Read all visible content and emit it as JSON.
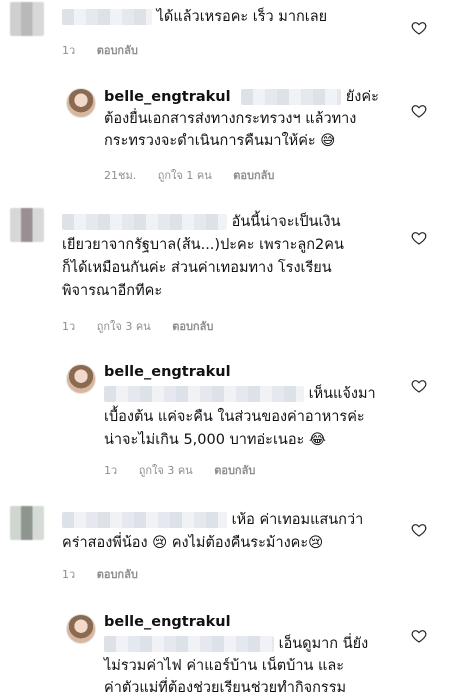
{
  "comments": [
    {
      "lines": [
        "ได้แล้วเหรอคะ  เร็ว มากเลย"
      ],
      "time": "1ว",
      "likes": "",
      "reply": "ตอบกลับ"
    },
    {
      "username": "belle_engtrakul",
      "lines": [
        "ยังค่ะ",
        "ต้องยื่นเอกสารส่งทางกระทรวงฯ แล้วทาง",
        "กระทรวงจะดำเนินการคืนมาให้ค่ะ 😅"
      ],
      "time": "21ชม.",
      "likes": "ถูกใจ 1 คน",
      "reply": "ตอบกลับ"
    },
    {
      "lines": [
        "อันนี้น่าจะเป็นเงิน",
        "เยียวยาจากรัฐบาล(ส้น...)ปะคะ เพราะลูก2คน",
        "ก็ได้เหมือนกันค่ะ ส่วนค่าเทอมทาง โรงเรียน",
        "พิจารณาอีกทีคะ"
      ],
      "time": "1ว",
      "likes": "ถูกใจ 3 คน",
      "reply": "ตอบกลับ"
    },
    {
      "username": "belle_engtrakul",
      "lines": [
        "เห็นแจ้งมา",
        "เบื้องต้น แค่จะคืน ในส่วนของค่าอาหารค่ะ",
        "น่าจะไม่เกิน 5,000 บาทอ่ะเนอะ 😂"
      ],
      "time": "1ว",
      "likes": "ถูกใจ 3 คน",
      "reply": "ตอบกลับ"
    },
    {
      "lines": [
        "เห้อ ค่าเทอมแสนกว่า",
        "คร่าสองพี่น้อง 😢  คงไม่ต้องคืนระม้างคะ😢"
      ],
      "time": "1ว",
      "likes": "",
      "reply": "ตอบกลับ"
    },
    {
      "username": "belle_engtrakul",
      "lines": [
        "เอ็นดูมาก นี่ยัง",
        "ไม่รวมค่าไฟ ค่าแอร์บ้าน เน็ตบ้าน และ",
        "ค่าตัวแม่ที่ต้องช่วยเรียนช่วยทำกิจกรรม"
      ]
    }
  ],
  "colors": {
    "meta": "#8e8e8e",
    "heart": "#262626"
  },
  "icons": {
    "like": "heart-outline-icon"
  }
}
